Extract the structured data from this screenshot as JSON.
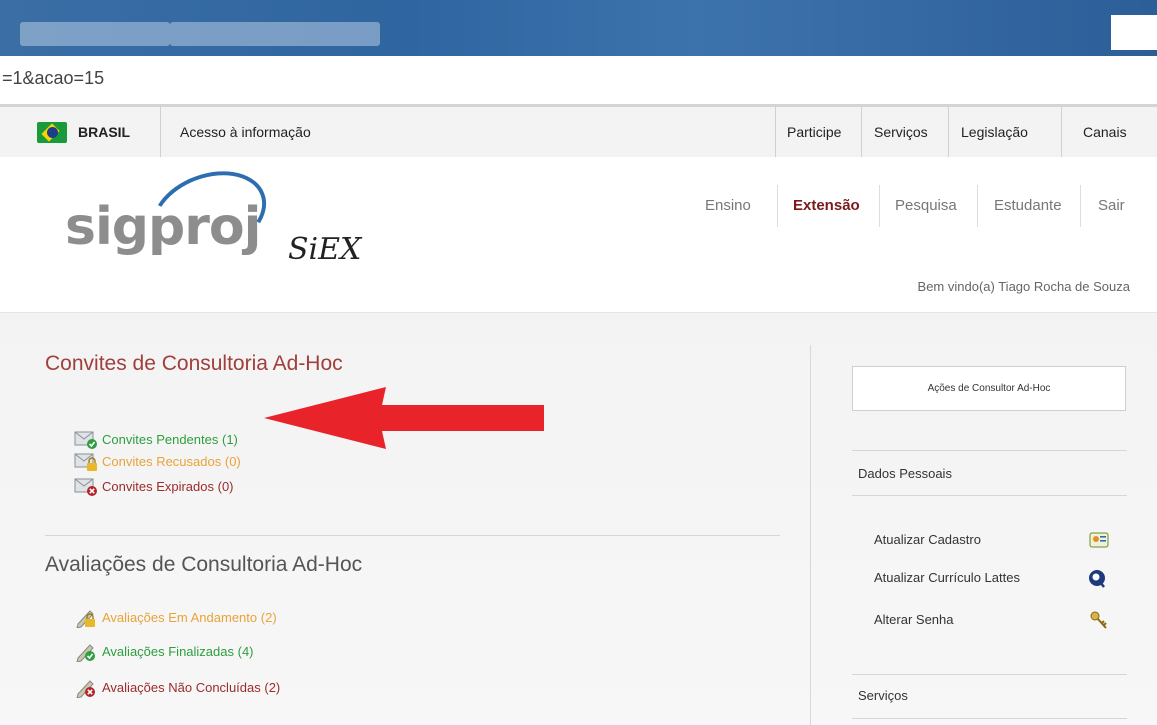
{
  "browser": {
    "address_fragment": "=1&acao=15"
  },
  "govbar": {
    "brasil": "BRASIL",
    "acesso": "Acesso à informação",
    "links": [
      "Participe",
      "Serviços",
      "Legislação",
      "Canais"
    ]
  },
  "nav": {
    "items": [
      "Ensino",
      "Extensão",
      "Pesquisa",
      "Estudante",
      "Sair"
    ],
    "active_color": "#7a1a1a",
    "welcome": "Bem vindo(a) Tiago Rocha de Souza"
  },
  "convites": {
    "title": "Convites de Consultoria Ad-Hoc",
    "items": [
      {
        "label": "Convites Pendentes",
        "count": "(1)",
        "color": "#2e9e3e"
      },
      {
        "label": "Convites Recusados",
        "count": "(0)",
        "color": "#e8a33a"
      },
      {
        "label": "Convites Expirados",
        "count": "(0)",
        "color": "#9c2b2b"
      }
    ]
  },
  "avaliacoes": {
    "title": "Avaliações de Consultoria Ad-Hoc",
    "items": [
      {
        "label": "Avaliações Em Andamento",
        "count": "(2)",
        "color": "#e8a33a"
      },
      {
        "label": "Avaliações Finalizadas",
        "count": "(4)",
        "color": "#2e9e3e"
      },
      {
        "label": "Avaliações Não Concluídas",
        "count": "(2)",
        "color": "#9c2b2b"
      }
    ]
  },
  "sidebar": {
    "action_box": "Ações de Consultor Ad-Hoc",
    "dados_title": "Dados Pessoais",
    "dados_links": [
      "Atualizar Cadastro",
      "Atualizar Currículo Lattes",
      "Alterar Senha"
    ],
    "servicos_title": "Serviços"
  },
  "colors": {
    "title_red": "#a0403c",
    "title_gray": "#555555",
    "arrow_red": "#e8232a"
  }
}
